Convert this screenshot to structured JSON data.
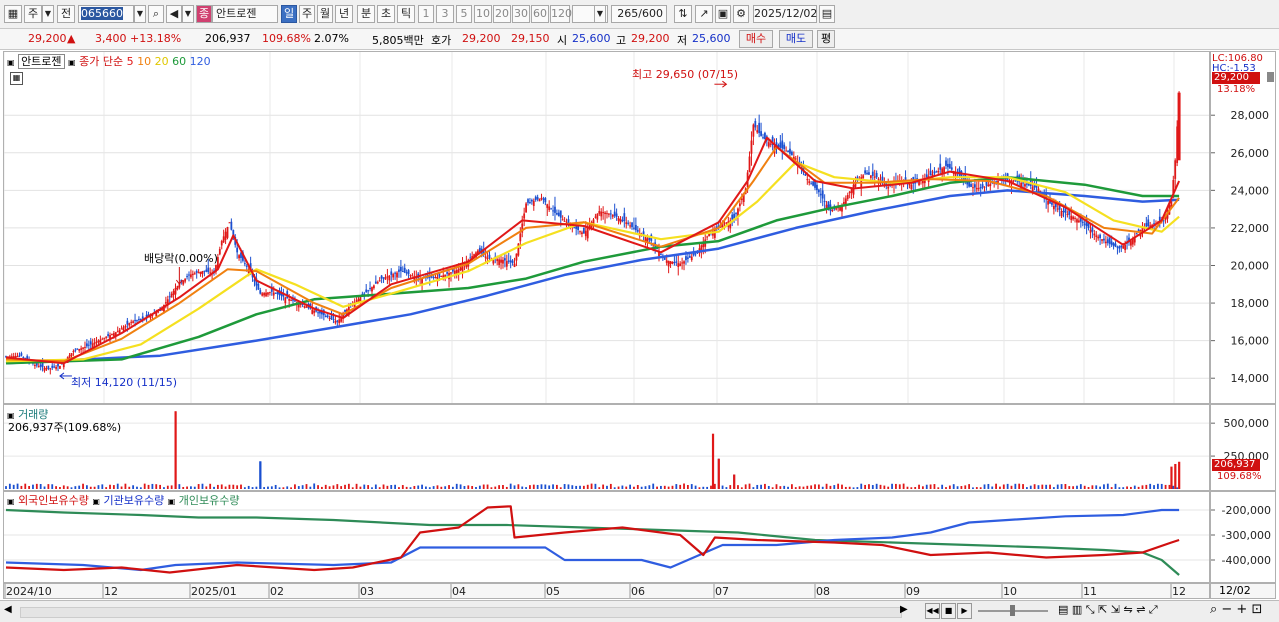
{
  "toolbar": {
    "tab1": "주",
    "tab2": "전",
    "code": "065660",
    "name_badge": "종",
    "name": "안트로젠",
    "periods": [
      "일",
      "주",
      "월",
      "년",
      "분",
      "초",
      "틱"
    ],
    "intervals": [
      "1",
      "3",
      "5",
      "10",
      "20",
      "30",
      "60",
      "120"
    ],
    "count": "265",
    "count_total": "/600",
    "date": "2025/12/02"
  },
  "info": {
    "price": "29,200",
    "change": "3,400",
    "change_pct": "+13.18%",
    "volume": "206,937",
    "vol_ratio": "109.68%",
    "turnover": "2.07%",
    "amount": "5,805백만",
    "hoga_label": "호가",
    "ask": "29,200",
    "bid": "29,150",
    "open_label": "시",
    "open": "25,600",
    "high_label": "고",
    "high": "29,200",
    "low_label": "저",
    "low": "25,600",
    "buy": "매수",
    "sell": "매도",
    "eval": "평"
  },
  "price_panel": {
    "legend_name": "안트로젠",
    "legend_ma": "종가 단순",
    "ma_periods": [
      "5",
      "10",
      "20",
      "60",
      "120"
    ],
    "ma_colors": [
      "#e01818",
      "#f08010",
      "#f5e020",
      "#1e9a3a",
      "#2f5de0"
    ],
    "max_label": "최고 29,650 (07/15)",
    "min_label": "최저 14,120 (11/15)",
    "dividend_label": "배당락(0.00%)",
    "right_top_lc": "LC:106.80",
    "right_top_hc": "HC:-1.53",
    "last_price": "29,200",
    "last_pct": "13.18%"
  },
  "volume_panel": {
    "legend": "거래량",
    "sub": "206,937주(109.68%)",
    "last_vol": "206,937",
    "last_pct": "109.68%"
  },
  "holdings_panel": {
    "foreign": "외국인보유수량",
    "inst": "기관보유수량",
    "indiv": "개인보유수량",
    "foreign_color": "#d01010",
    "inst_color": "#2f5de0",
    "indiv_color": "#2e8b57"
  },
  "chart_data": {
    "type": "line",
    "price": {
      "ylim": [
        13000,
        30300
      ],
      "y_ticks": [
        14000,
        16000,
        18000,
        20000,
        22000,
        24000,
        26000,
        28000
      ],
      "y_tick_labels": [
        "14,000",
        "16,000",
        "18,000",
        "20,000",
        "22,000",
        "24,000",
        "26,000",
        "28,000"
      ],
      "x_labels": [
        "2024/10",
        "12",
        "2025/01",
        "02",
        "03",
        "04",
        "05",
        "06",
        "07",
        "08",
        "09",
        "10",
        "11",
        "12"
      ],
      "close_series": [
        [
          0,
          15150
        ],
        [
          8,
          15200
        ],
        [
          15,
          14700
        ],
        [
          22,
          14500
        ],
        [
          28,
          14650
        ],
        [
          35,
          15450
        ],
        [
          42,
          15700
        ],
        [
          50,
          16100
        ],
        [
          58,
          16500
        ],
        [
          65,
          17000
        ],
        [
          72,
          17200
        ],
        [
          80,
          17600
        ],
        [
          88,
          18800
        ],
        [
          95,
          19500
        ],
        [
          102,
          19700
        ],
        [
          108,
          19600
        ],
        [
          112,
          21300
        ],
        [
          116,
          22300
        ],
        [
          120,
          20700
        ],
        [
          126,
          19800
        ],
        [
          132,
          18500
        ],
        [
          138,
          18600
        ],
        [
          145,
          18300
        ],
        [
          152,
          18000
        ],
        [
          160,
          17600
        ],
        [
          168,
          17200
        ],
        [
          172,
          17000
        ],
        [
          178,
          17800
        ],
        [
          185,
          18400
        ],
        [
          195,
          19300
        ],
        [
          205,
          19700
        ],
        [
          215,
          19300
        ],
        [
          225,
          19400
        ],
        [
          235,
          19800
        ],
        [
          245,
          20800
        ],
        [
          250,
          20400
        ],
        [
          258,
          20300
        ],
        [
          264,
          20100
        ],
        [
          270,
          23300
        ],
        [
          278,
          23600
        ],
        [
          285,
          22800
        ],
        [
          292,
          22200
        ],
        [
          300,
          21700
        ],
        [
          308,
          22900
        ],
        [
          315,
          22700
        ],
        [
          322,
          22300
        ],
        [
          328,
          21800
        ],
        [
          335,
          21300
        ],
        [
          342,
          20300
        ],
        [
          350,
          20100
        ],
        [
          358,
          20600
        ],
        [
          365,
          21700
        ],
        [
          372,
          22200
        ],
        [
          378,
          22500
        ],
        [
          384,
          24100
        ],
        [
          388,
          27500
        ],
        [
          392,
          26900
        ],
        [
          398,
          26400
        ],
        [
          404,
          26200
        ],
        [
          410,
          25700
        ],
        [
          416,
          24600
        ],
        [
          422,
          23900
        ],
        [
          428,
          22900
        ],
        [
          434,
          23200
        ],
        [
          440,
          24300
        ],
        [
          446,
          24900
        ],
        [
          452,
          24700
        ],
        [
          458,
          24200
        ],
        [
          464,
          24500
        ],
        [
          470,
          24300
        ],
        [
          476,
          24600
        ],
        [
          482,
          24900
        ],
        [
          488,
          25300
        ],
        [
          494,
          24900
        ],
        [
          500,
          24200
        ],
        [
          506,
          24100
        ],
        [
          512,
          24400
        ],
        [
          518,
          24600
        ],
        [
          524,
          24500
        ],
        [
          530,
          24300
        ],
        [
          536,
          24100
        ],
        [
          542,
          23300
        ],
        [
          548,
          22900
        ],
        [
          554,
          22600
        ],
        [
          560,
          22200
        ],
        [
          566,
          21600
        ],
        [
          572,
          21200
        ],
        [
          578,
          20900
        ],
        [
          584,
          21300
        ],
        [
          590,
          22000
        ],
        [
          596,
          22200
        ],
        [
          601,
          22400
        ],
        [
          605,
          23500
        ],
        [
          607,
          25600
        ],
        [
          609,
          29200
        ]
      ],
      "ma5": [
        [
          0,
          15100
        ],
        [
          30,
          14800
        ],
        [
          60,
          16400
        ],
        [
          90,
          18300
        ],
        [
          110,
          19800
        ],
        [
          118,
          21600
        ],
        [
          130,
          19200
        ],
        [
          160,
          17700
        ],
        [
          175,
          17200
        ],
        [
          200,
          19000
        ],
        [
          240,
          20200
        ],
        [
          268,
          22400
        ],
        [
          300,
          22100
        ],
        [
          340,
          20700
        ],
        [
          370,
          22300
        ],
        [
          385,
          24500
        ],
        [
          395,
          26800
        ],
        [
          420,
          24500
        ],
        [
          440,
          24100
        ],
        [
          470,
          24400
        ],
        [
          490,
          25000
        ],
        [
          520,
          24500
        ],
        [
          550,
          23100
        ],
        [
          580,
          21100
        ],
        [
          600,
          22400
        ],
        [
          609,
          24500
        ]
      ],
      "ma10": [
        [
          0,
          15000
        ],
        [
          30,
          14900
        ],
        [
          60,
          16100
        ],
        [
          90,
          18000
        ],
        [
          115,
          19800
        ],
        [
          130,
          19700
        ],
        [
          160,
          18000
        ],
        [
          175,
          17400
        ],
        [
          200,
          18800
        ],
        [
          240,
          20100
        ],
        [
          270,
          22000
        ],
        [
          300,
          22300
        ],
        [
          340,
          21000
        ],
        [
          370,
          22000
        ],
        [
          388,
          24500
        ],
        [
          400,
          26300
        ],
        [
          425,
          24400
        ],
        [
          450,
          24400
        ],
        [
          480,
          24600
        ],
        [
          510,
          24500
        ],
        [
          540,
          23700
        ],
        [
          570,
          22000
        ],
        [
          595,
          21700
        ],
        [
          609,
          23600
        ]
      ],
      "ma20": [
        [
          0,
          14900
        ],
        [
          40,
          15000
        ],
        [
          70,
          15800
        ],
        [
          100,
          17700
        ],
        [
          130,
          19800
        ],
        [
          150,
          19000
        ],
        [
          175,
          17800
        ],
        [
          200,
          18500
        ],
        [
          240,
          19700
        ],
        [
          270,
          21200
        ],
        [
          300,
          22300
        ],
        [
          340,
          21400
        ],
        [
          370,
          21800
        ],
        [
          390,
          23400
        ],
        [
          410,
          25500
        ],
        [
          430,
          24700
        ],
        [
          460,
          24400
        ],
        [
          490,
          24700
        ],
        [
          520,
          24700
        ],
        [
          550,
          23900
        ],
        [
          575,
          22400
        ],
        [
          600,
          21800
        ],
        [
          609,
          22600
        ]
      ],
      "ma60": [
        [
          0,
          14800
        ],
        [
          60,
          15000
        ],
        [
          100,
          16200
        ],
        [
          130,
          17400
        ],
        [
          160,
          18200
        ],
        [
          200,
          18500
        ],
        [
          240,
          18800
        ],
        [
          270,
          19300
        ],
        [
          300,
          20200
        ],
        [
          340,
          21000
        ],
        [
          370,
          21300
        ],
        [
          400,
          22400
        ],
        [
          430,
          23100
        ],
        [
          460,
          23700
        ],
        [
          490,
          24400
        ],
        [
          520,
          24700
        ],
        [
          560,
          24300
        ],
        [
          590,
          23700
        ],
        [
          609,
          23700
        ]
      ],
      "ma120": [
        [
          0,
          14800
        ],
        [
          80,
          15200
        ],
        [
          130,
          16000
        ],
        [
          170,
          16700
        ],
        [
          210,
          17400
        ],
        [
          250,
          18400
        ],
        [
          290,
          19500
        ],
        [
          330,
          20300
        ],
        [
          370,
          20900
        ],
        [
          410,
          22000
        ],
        [
          450,
          22900
        ],
        [
          490,
          23700
        ],
        [
          520,
          24000
        ],
        [
          560,
          23700
        ],
        [
          590,
          23400
        ],
        [
          609,
          23500
        ]
      ],
      "max_point": {
        "x": 374,
        "y": 29650
      },
      "min_point": {
        "x": 28,
        "y": 14120
      },
      "dividend_x": 90
    },
    "volume": {
      "ylim": [
        0,
        600000
      ],
      "y_ticks": [
        500000,
        250000
      ],
      "y_tick_labels": [
        "500,000",
        "250,000"
      ],
      "spikes": [
        [
          88,
          590000
        ],
        [
          132,
          210000
        ],
        [
          367,
          420000
        ],
        [
          370,
          230000
        ],
        [
          378,
          110000
        ],
        [
          605,
          170000
        ],
        [
          607,
          190000
        ],
        [
          609,
          206937
        ]
      ]
    },
    "holdings": {
      "ylim": [
        -480000,
        -160000
      ],
      "y_ticks": [
        -200000,
        -300000,
        -400000
      ],
      "y_tick_labels": [
        "-200,000",
        "-300,000",
        "-400,000"
      ],
      "foreign": [
        [
          0,
          -430000
        ],
        [
          30,
          -440000
        ],
        [
          60,
          -430000
        ],
        [
          85,
          -450000
        ],
        [
          120,
          -420000
        ],
        [
          160,
          -440000
        ],
        [
          180,
          -430000
        ],
        [
          205,
          -390000
        ],
        [
          215,
          -290000
        ],
        [
          235,
          -270000
        ],
        [
          250,
          -190000
        ],
        [
          262,
          -185000
        ],
        [
          264,
          -310000
        ],
        [
          290,
          -290000
        ],
        [
          320,
          -270000
        ],
        [
          350,
          -300000
        ],
        [
          362,
          -380000
        ],
        [
          368,
          -310000
        ],
        [
          390,
          -320000
        ],
        [
          430,
          -330000
        ],
        [
          455,
          -340000
        ],
        [
          480,
          -380000
        ],
        [
          510,
          -370000
        ],
        [
          540,
          -390000
        ],
        [
          570,
          -380000
        ],
        [
          590,
          -370000
        ],
        [
          605,
          -330000
        ],
        [
          609,
          -320000
        ]
      ],
      "institution": [
        [
          0,
          -410000
        ],
        [
          40,
          -420000
        ],
        [
          70,
          -440000
        ],
        [
          88,
          -420000
        ],
        [
          120,
          -410000
        ],
        [
          170,
          -420000
        ],
        [
          200,
          -410000
        ],
        [
          215,
          -350000
        ],
        [
          240,
          -350000
        ],
        [
          280,
          -350000
        ],
        [
          290,
          -400000
        ],
        [
          330,
          -400000
        ],
        [
          345,
          -430000
        ],
        [
          360,
          -380000
        ],
        [
          372,
          -340000
        ],
        [
          400,
          -340000
        ],
        [
          430,
          -320000
        ],
        [
          460,
          -310000
        ],
        [
          480,
          -290000
        ],
        [
          500,
          -250000
        ],
        [
          520,
          -240000
        ],
        [
          550,
          -225000
        ],
        [
          580,
          -220000
        ],
        [
          600,
          -200000
        ],
        [
          609,
          -200000
        ]
      ],
      "individual": [
        [
          0,
          -200000
        ],
        [
          30,
          -210000
        ],
        [
          70,
          -220000
        ],
        [
          100,
          -230000
        ],
        [
          130,
          -230000
        ],
        [
          170,
          -240000
        ],
        [
          220,
          -260000
        ],
        [
          260,
          -260000
        ],
        [
          300,
          -270000
        ],
        [
          340,
          -280000
        ],
        [
          380,
          -290000
        ],
        [
          420,
          -320000
        ],
        [
          460,
          -330000
        ],
        [
          500,
          -340000
        ],
        [
          540,
          -350000
        ],
        [
          570,
          -360000
        ],
        [
          590,
          -370000
        ],
        [
          600,
          -400000
        ],
        [
          609,
          -460000
        ]
      ]
    }
  }
}
